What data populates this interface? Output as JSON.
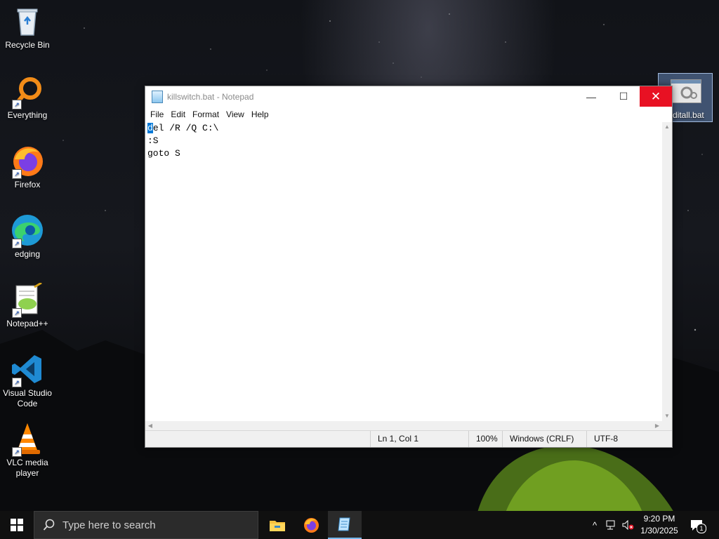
{
  "desktop": {
    "icons": [
      {
        "label": "Recycle Bin",
        "icon": "recycle-bin-icon"
      },
      {
        "label": "Everything",
        "icon": "everything-search-icon"
      },
      {
        "label": "Firefox",
        "icon": "firefox-icon"
      },
      {
        "label": "edging",
        "icon": "edge-browser-icon"
      },
      {
        "label": "Notepad++",
        "icon": "notepad-plus-plus-icon"
      },
      {
        "label": "Visual Studio Code",
        "icon": "vscode-icon"
      },
      {
        "label": "VLC media player",
        "icon": "vlc-icon"
      },
      {
        "label": "ditall.bat",
        "icon": "batch-file-icon"
      }
    ]
  },
  "notepad": {
    "title": "killswitch.bat - Notepad",
    "menu": [
      "File",
      "Edit",
      "Format",
      "View",
      "Help"
    ],
    "lines": [
      {
        "selected": "d",
        "rest": "el /R /Q C:\\"
      },
      {
        "selected": "",
        "rest": ":S"
      },
      {
        "selected": "",
        "rest": "goto S"
      }
    ],
    "status": {
      "position": "Ln 1, Col 1",
      "zoom": "100%",
      "line_ending": "Windows (CRLF)",
      "encoding": "UTF-8"
    },
    "controls": {
      "minimize": "—",
      "maximize": "☐",
      "close": "✕"
    }
  },
  "taskbar": {
    "search_placeholder": "Type here to search",
    "apps": [
      "file-explorer-icon",
      "firefox-icon",
      "notepad-icon"
    ],
    "time": "9:20 PM",
    "date": "1/30/2025",
    "notification_count": "1"
  },
  "colors": {
    "close_red": "#e81123",
    "selection_blue": "#0078d7",
    "taskbar": "#101010"
  }
}
